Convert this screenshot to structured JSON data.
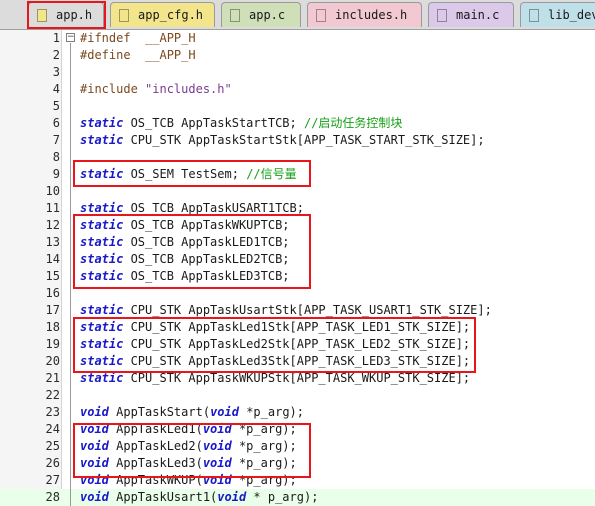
{
  "tabs": [
    {
      "label": "app.h",
      "color": "#f2e58c",
      "active": true
    },
    {
      "label": "app_cfg.h",
      "color": "#f2e58c",
      "active": false
    },
    {
      "label": "app.c",
      "color": "#cfe0b8",
      "active": false
    },
    {
      "label": "includes.h",
      "color": "#f2c8d2",
      "active": false
    },
    {
      "label": "main.c",
      "color": "#dcc8e8",
      "active": false
    },
    {
      "label": "lib_dev",
      "color": "#bfe0e8",
      "active": false
    }
  ],
  "code_lines": [
    {
      "n": "1",
      "t": [
        [
          "pp",
          "#ifndef  __APP_H"
        ]
      ]
    },
    {
      "n": "2",
      "t": [
        [
          "pp",
          "#define  __APP_H"
        ]
      ]
    },
    {
      "n": "3",
      "t": []
    },
    {
      "n": "4",
      "t": [
        [
          "pp",
          "#include "
        ],
        [
          "str",
          "\"includes.h\""
        ]
      ]
    },
    {
      "n": "5",
      "t": []
    },
    {
      "n": "6",
      "t": [
        [
          "kw",
          "static"
        ],
        [
          "",
          " OS_TCB AppTaskStartTCB; "
        ],
        [
          "cm",
          "//启动任务控制块"
        ]
      ]
    },
    {
      "n": "7",
      "t": [
        [
          "kw",
          "static"
        ],
        [
          "",
          " CPU_STK AppTaskStartStk[APP_TASK_START_STK_SIZE];"
        ]
      ]
    },
    {
      "n": "8",
      "t": []
    },
    {
      "n": "9",
      "t": [
        [
          "kw",
          "static"
        ],
        [
          "",
          " OS_SEM TestSem; "
        ],
        [
          "cm",
          "//信号量"
        ]
      ]
    },
    {
      "n": "10",
      "t": []
    },
    {
      "n": "11",
      "t": [
        [
          "kw",
          "static"
        ],
        [
          "",
          " OS_TCB AppTaskUSART1TCB;"
        ]
      ]
    },
    {
      "n": "12",
      "t": [
        [
          "kw",
          "static"
        ],
        [
          "",
          " OS_TCB AppTaskWKUPTCB;"
        ]
      ]
    },
    {
      "n": "13",
      "t": [
        [
          "kw",
          "static"
        ],
        [
          "",
          " OS_TCB AppTaskLED1TCB;"
        ]
      ]
    },
    {
      "n": "14",
      "t": [
        [
          "kw",
          "static"
        ],
        [
          "",
          " OS_TCB AppTaskLED2TCB;"
        ]
      ]
    },
    {
      "n": "15",
      "t": [
        [
          "kw",
          "static"
        ],
        [
          "",
          " OS_TCB AppTaskLED3TCB;"
        ]
      ]
    },
    {
      "n": "16",
      "t": []
    },
    {
      "n": "17",
      "t": [
        [
          "kw",
          "static"
        ],
        [
          "",
          " CPU_STK AppTaskUsartStk[APP_TASK_USART1_STK_SIZE];"
        ]
      ]
    },
    {
      "n": "18",
      "t": [
        [
          "kw",
          "static"
        ],
        [
          "",
          " CPU_STK AppTaskLed1Stk[APP_TASK_LED1_STK_SIZE];"
        ]
      ]
    },
    {
      "n": "19",
      "t": [
        [
          "kw",
          "static"
        ],
        [
          "",
          " CPU_STK AppTaskLed2Stk[APP_TASK_LED2_STK_SIZE];"
        ]
      ]
    },
    {
      "n": "20",
      "t": [
        [
          "kw",
          "static"
        ],
        [
          "",
          " CPU_STK AppTaskLed3Stk[APP_TASK_LED3_STK_SIZE];"
        ]
      ]
    },
    {
      "n": "21",
      "t": [
        [
          "kw",
          "static"
        ],
        [
          "",
          " CPU_STK AppTaskWKUPStk[APP_TASK_WKUP_STK_SIZE];"
        ]
      ]
    },
    {
      "n": "22",
      "t": []
    },
    {
      "n": "23",
      "t": [
        [
          "kw",
          "void"
        ],
        [
          "",
          " AppTaskStart("
        ],
        [
          "kw",
          "void"
        ],
        [
          "",
          " *p_arg);"
        ]
      ]
    },
    {
      "n": "24",
      "t": [
        [
          "kw",
          "void"
        ],
        [
          "",
          " AppTaskLed1("
        ],
        [
          "kw",
          "void"
        ],
        [
          "",
          " *p_arg);"
        ]
      ]
    },
    {
      "n": "25",
      "t": [
        [
          "kw",
          "void"
        ],
        [
          "",
          " AppTaskLed2("
        ],
        [
          "kw",
          "void"
        ],
        [
          "",
          " *p_arg);"
        ]
      ]
    },
    {
      "n": "26",
      "t": [
        [
          "kw",
          "void"
        ],
        [
          "",
          " AppTaskLed3("
        ],
        [
          "kw",
          "void"
        ],
        [
          "",
          " *p_arg);"
        ]
      ]
    },
    {
      "n": "27",
      "t": [
        [
          "kw",
          "void"
        ],
        [
          "",
          " AppTaskWKUP("
        ],
        [
          "kw",
          "void"
        ],
        [
          "",
          " *p_arg);"
        ]
      ]
    },
    {
      "n": "28",
      "t": [
        [
          "kw",
          "void"
        ],
        [
          "",
          " AppTaskUsart1("
        ],
        [
          "kw",
          "void"
        ],
        [
          "",
          " * p_arg);"
        ]
      ]
    }
  ],
  "current_line": "28",
  "fold_marker": "−",
  "annotation_color": "#e8161b"
}
